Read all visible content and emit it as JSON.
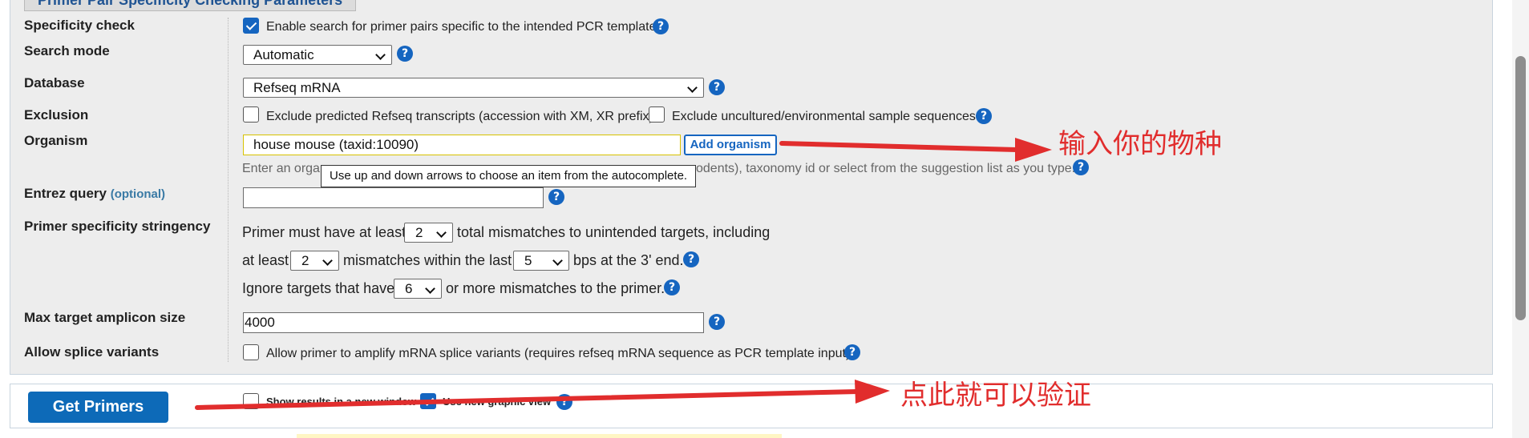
{
  "section": {
    "legend": "Primer Pair Specificity Checking Parameters"
  },
  "rows": {
    "specificity_check": {
      "label": "Specificity check",
      "checked": true,
      "text": "Enable search for primer pairs specific to the intended PCR template"
    },
    "search_mode": {
      "label": "Search mode",
      "value": "Automatic"
    },
    "database": {
      "label": "Database",
      "value": "Refseq mRNA"
    },
    "exclusion": {
      "label": "Exclusion",
      "opt1": "Exclude predicted Refseq transcripts (accession with XM, XR prefix)",
      "opt2": "Exclude uncultured/environmental sample sequences"
    },
    "organism": {
      "label": "Organism",
      "value": "house mouse (taxid:10090)",
      "add_button": "Add organism",
      "hint_left": "Enter an organ",
      "hint_right": "odents), taxonomy id or select from the suggestion list as you type.",
      "tooltip": "Use up and down arrows to choose an item from the autocomplete."
    },
    "entrez_query": {
      "label": "Entrez query",
      "optional": "(optional)",
      "value": ""
    },
    "stringency": {
      "label": "Primer specificity stringency",
      "line1_a": "Primer must have at least",
      "line1_val": "2",
      "line1_b": "total mismatches to unintended targets, including",
      "line2_a": "at least",
      "line2_val1": "2",
      "line2_b": "mismatches within the last",
      "line2_val2": "5",
      "line2_c": "bps at the 3' end.",
      "line3_a": "Ignore targets that have",
      "line3_val": "6",
      "line3_b": "or more mismatches to the primer."
    },
    "max_amplicon": {
      "label": "Max target amplicon size",
      "value": "4000"
    },
    "splice": {
      "label": "Allow splice variants",
      "text": "Allow primer to amplify mRNA splice variants (requires refseq mRNA sequence as PCR template input)"
    }
  },
  "bottom": {
    "get_primers": "Get Primers",
    "show_results": "Show results in a new window",
    "use_graphic": "Use new graphic view"
  },
  "annotations": {
    "organism_note": "输入你的物种",
    "submit_note": "点此就可以验证"
  },
  "help_icon": "?",
  "colors": {
    "accent": "#1565c0",
    "annotation": "#e12d2d",
    "panel": "#ededed"
  }
}
